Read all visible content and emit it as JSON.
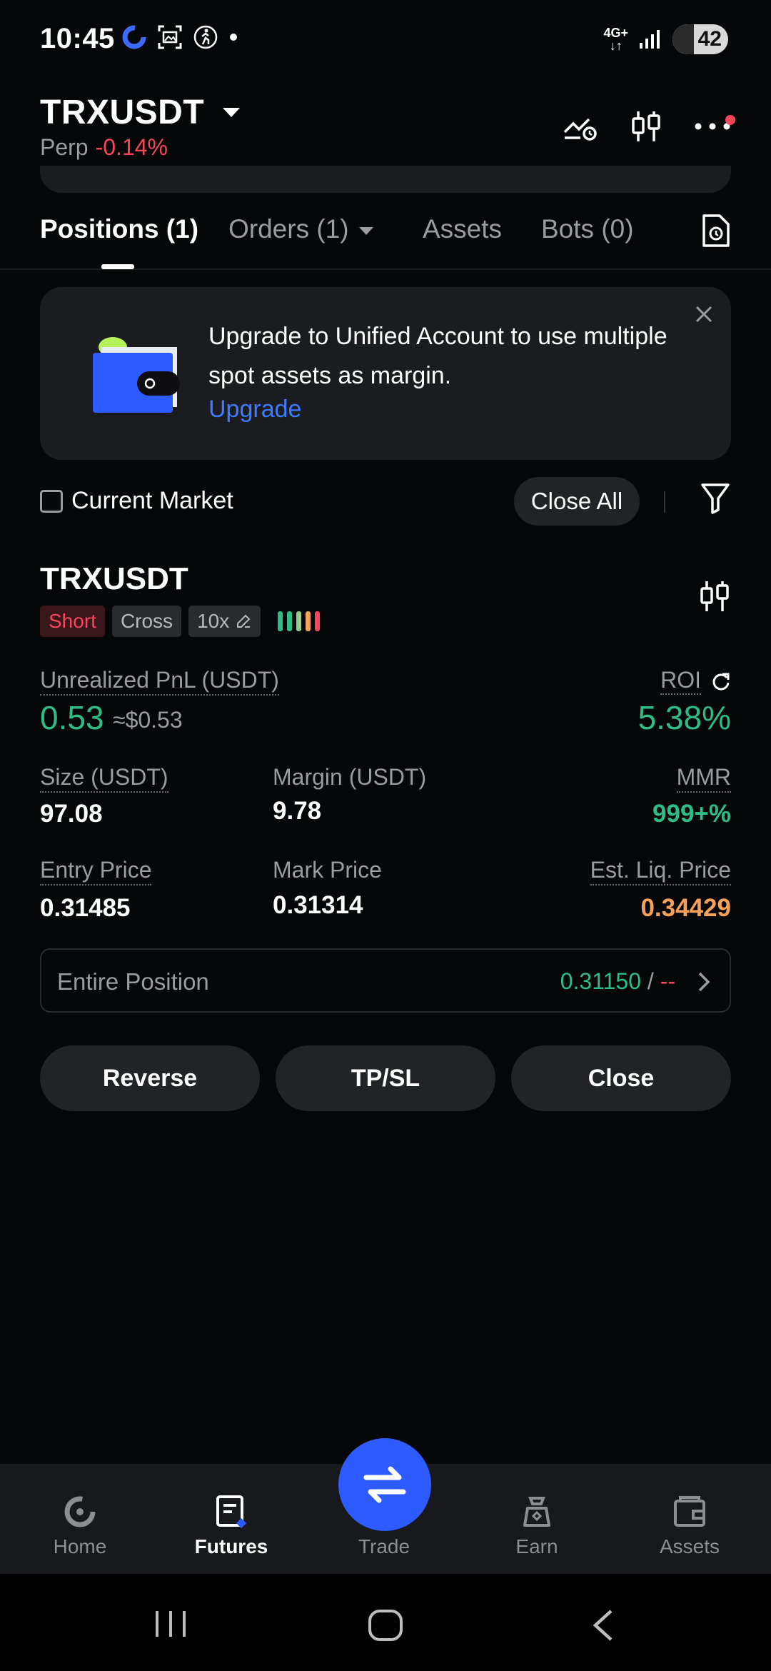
{
  "status_bar": {
    "time": "10:45",
    "battery": "42",
    "network": "4G+"
  },
  "header": {
    "symbol": "TRXUSDT",
    "contract_type": "Perp",
    "change": "-0.14%"
  },
  "tabs": [
    {
      "label": "Positions (1)",
      "active": true
    },
    {
      "label": "Orders (1)",
      "active": false
    },
    {
      "label": "Assets",
      "active": false
    },
    {
      "label": "Bots (0)",
      "active": false
    }
  ],
  "banner": {
    "text": "Upgrade to Unified Account to use multiple spot assets as margin.",
    "link": "Upgrade"
  },
  "filter": {
    "current_market_label": "Current Market",
    "current_market_checked": false,
    "close_all_label": "Close All"
  },
  "position": {
    "symbol": "TRXUSDT",
    "side": "Short",
    "margin_mode": "Cross",
    "leverage": "10x",
    "adl_colors": [
      "#2ebd85",
      "#2ebd85",
      "#8fd18a",
      "#f5a15b",
      "#f6465d"
    ],
    "unrealized_pnl_label": "Unrealized PnL (USDT)",
    "unrealized_pnl": "0.53",
    "unrealized_pnl_usd": "≈$0.53",
    "roi_label": "ROI",
    "roi": "5.38%",
    "size_label": "Size (USDT)",
    "size": "97.08",
    "margin_label": "Margin (USDT)",
    "margin": "9.78",
    "mmr_label": "MMR",
    "mmr": "999+%",
    "entry_price_label": "Entry Price",
    "entry_price": "0.31485",
    "mark_price_label": "Mark Price",
    "mark_price": "0.31314",
    "liq_price_label": "Est. Liq. Price",
    "liq_price": "0.34429",
    "entire_position_label": "Entire Position",
    "tp_value": "0.31150",
    "tp_sep": " / ",
    "sl_value": "--"
  },
  "actions": {
    "reverse": "Reverse",
    "tpsl": "TP/SL",
    "close": "Close"
  },
  "bottom_nav": [
    {
      "label": "Home",
      "icon": "home-icon",
      "active": false
    },
    {
      "label": "Futures",
      "icon": "futures-icon",
      "active": true
    },
    {
      "label": "Trade",
      "icon": "trade-icon",
      "active": false
    },
    {
      "label": "Earn",
      "icon": "earn-icon",
      "active": false
    },
    {
      "label": "Assets",
      "icon": "assets-icon",
      "active": false
    }
  ],
  "colors": {
    "accent": "#2e5bff",
    "positive": "#2ebd85",
    "negative": "#f6465d",
    "warning": "#f5a15b",
    "link": "#3d7bff"
  }
}
